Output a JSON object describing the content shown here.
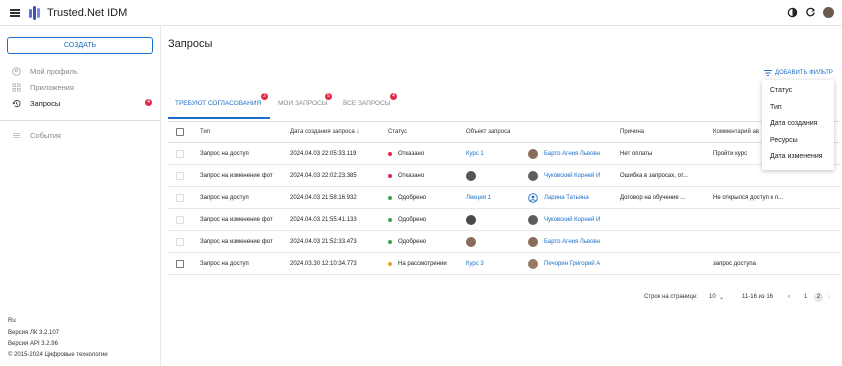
{
  "app": {
    "title": "Trusted.Net IDM"
  },
  "sidebar": {
    "create_label": "СОЗДАТЬ",
    "items": [
      {
        "label": "Мой профиль",
        "icon": "profile-icon"
      },
      {
        "label": "Приложения",
        "icon": "apps-grid-icon"
      },
      {
        "label": "Запросы",
        "icon": "history-icon",
        "badge": "4"
      },
      {
        "label": "События",
        "icon": "list-icon"
      }
    ],
    "footer": {
      "lang": "Ru",
      "lk_version": "Версия ЛК 3.2.107",
      "api_version": "Версия API 3.2.96",
      "copyright": "© 2015-2024 Цифровые технологии"
    }
  },
  "main": {
    "title": "Запросы",
    "add_filter_label": "ДОБАВИТЬ ФИЛЬТР",
    "tabs": [
      {
        "label": "ТРЕБУЮТ СОГЛАСОВАНИЯ",
        "badge": "2"
      },
      {
        "label": "МОИ ЗАПРОСЫ",
        "badge": "5"
      },
      {
        "label": "ВСЕ ЗАПРОСЫ",
        "badge": "4"
      }
    ],
    "columns": [
      "Тип",
      "Дата создания запроса ↓",
      "Статус",
      "Объект запроса",
      "Причина",
      "Комментарий ав"
    ],
    "rows": [
      {
        "type": "Запрос на доступ",
        "date": "2024.04.03 22:05:33.119",
        "status": "Отказано",
        "object": "Курс 1",
        "person": "Барто Агния Львовн",
        "reason": "Нет оплаты",
        "comment": "Пройти курс"
      },
      {
        "type": "Запрос на изменение фот",
        "date": "2024.04.03 22:02:23.385",
        "status": "Отказано",
        "object": "",
        "person": "Чуковский Корней И",
        "reason": "Ошибка в запросах, от...",
        "comment": ""
      },
      {
        "type": "Запрос на доступ",
        "date": "2024.04.03 21:58:16.932",
        "status": "Одобрено",
        "object": "Лекция 1",
        "person": "Ларина Татьяна",
        "reason": "Договор на обучение ...",
        "comment": "Не открылся доступ к п..."
      },
      {
        "type": "Запрос на изменение фот",
        "date": "2024.04.03 21:55:41.133",
        "status": "Одобрено",
        "object": "",
        "person": "Чуковский Корней И",
        "reason": "",
        "comment": ""
      },
      {
        "type": "Запрос на изменение фот",
        "date": "2024.04.03 21:52:33.473",
        "status": "Одобрено",
        "object": "",
        "person": "Барто Агния Львовн",
        "reason": "",
        "comment": ""
      },
      {
        "type": "Запрос на доступ",
        "date": "2024.03.30 12:10:34.773",
        "status": "На рассмотрении",
        "object": "Курс 3",
        "person": "Печорин Григорий А",
        "reason": "",
        "comment": "запрос доступа"
      }
    ],
    "pager": {
      "rows_label": "Строк на странице:",
      "rows_value": "10",
      "range": "11-16 из 16",
      "pages": [
        "1",
        "2"
      ],
      "current_page": "2"
    }
  },
  "filter_menu": {
    "options": [
      "Статус",
      "Тип",
      "Дата создания",
      "Ресурсы",
      "Дата изменения"
    ]
  },
  "colors": {
    "accent": "#1e6fc8",
    "denied": "#e0284b",
    "approved": "#43a047",
    "pending": "#f0a030"
  }
}
